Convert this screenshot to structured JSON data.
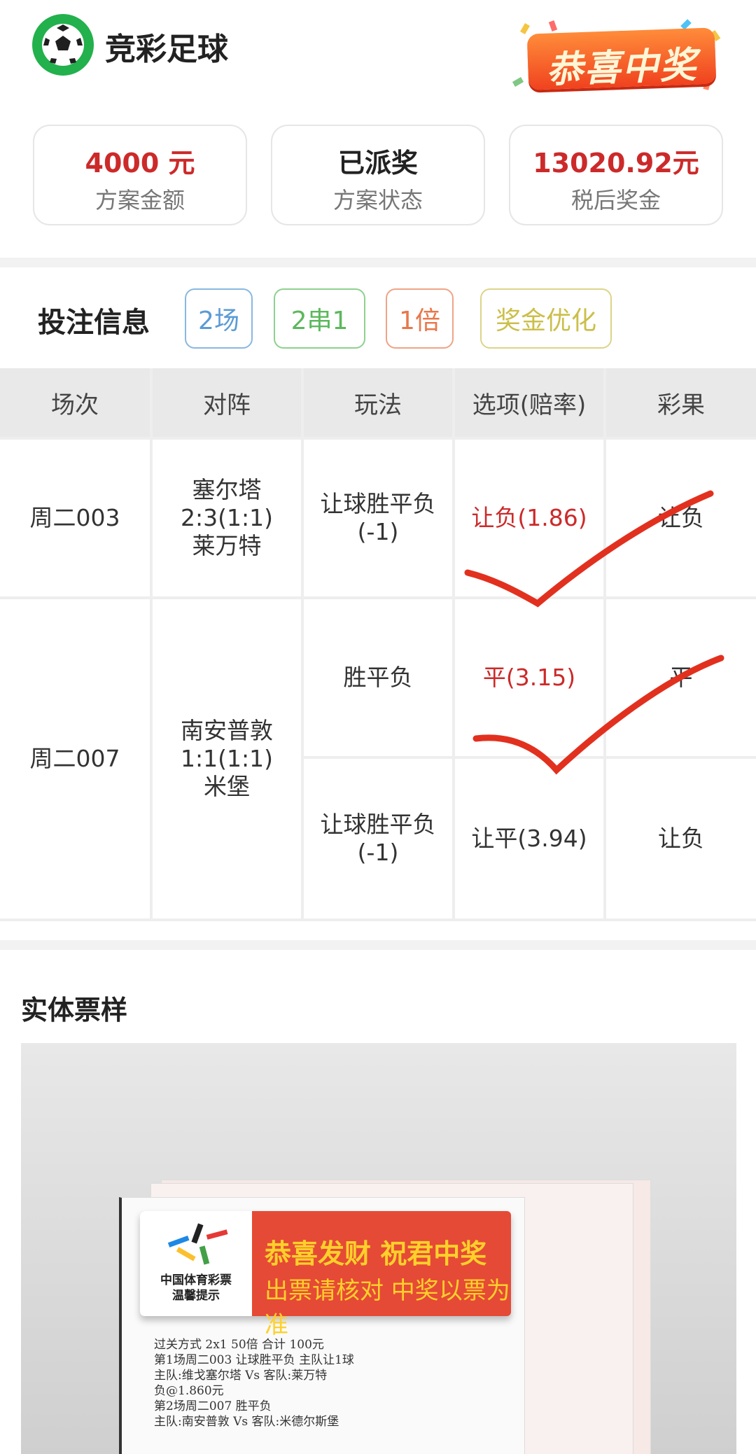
{
  "header": {
    "app_title": "竞彩足球",
    "logo_icon": "soccer-ball-icon",
    "congrats_badge": "恭喜中奖"
  },
  "summary": [
    {
      "value": "4000 元",
      "label": "方案金额",
      "color": "#cc2a2a"
    },
    {
      "value": "已派奖",
      "label": "方案状态",
      "color": "#222222"
    },
    {
      "value": "13020.92元",
      "label": "税后奖金",
      "color": "#cc2a2a"
    }
  ],
  "bet_info": {
    "title": "投注信息",
    "tags": [
      {
        "label": "2场",
        "color": "#5b9bd5"
      },
      {
        "label": "2串1",
        "color": "#5cb85c"
      },
      {
        "label": "1倍",
        "color": "#e8774a"
      },
      {
        "label": "奖金优化",
        "color": "#cbbf4a"
      }
    ]
  },
  "table": {
    "headers": [
      "场次",
      "对阵",
      "玩法",
      "选项(赔率)",
      "彩果"
    ],
    "rows": [
      {
        "match_no": "周二003",
        "teams": [
          "塞尔塔",
          "2:3(1:1)",
          "莱万特"
        ],
        "plays": [
          {
            "type": [
              "让球胜平负",
              "(-1)"
            ],
            "option": "让负(1.86)",
            "option_hit": true,
            "result": "让负"
          }
        ]
      },
      {
        "match_no": "周二007",
        "teams": [
          "南安普敦",
          "1:1(1:1)",
          "米堡"
        ],
        "plays": [
          {
            "type": [
              "胜平负"
            ],
            "option": "平(3.15)",
            "option_hit": true,
            "result": "平"
          },
          {
            "type": [
              "让球胜平负",
              "(-1)"
            ],
            "option": "让平(3.94)",
            "option_hit": false,
            "result": "让负"
          }
        ]
      }
    ]
  },
  "ticket": {
    "title": "实体票样",
    "acrylic": {
      "org": [
        "中国体育彩票",
        "温馨提示"
      ],
      "line1": "恭喜发财 祝君中奖",
      "line2": "出票请核对 中奖以票为准"
    },
    "print_lines": [
      "过关方式  2x1          50倍          合计  100元",
      "第1场周二003  让球胜平负   主队让1球",
      "主队:维戈塞尔塔 Vs 客队:莱万特",
      "负@1.860元",
      "第2场周二007  胜平负",
      "主队:南安普敦  Vs  客队:米德尔斯堡"
    ]
  }
}
